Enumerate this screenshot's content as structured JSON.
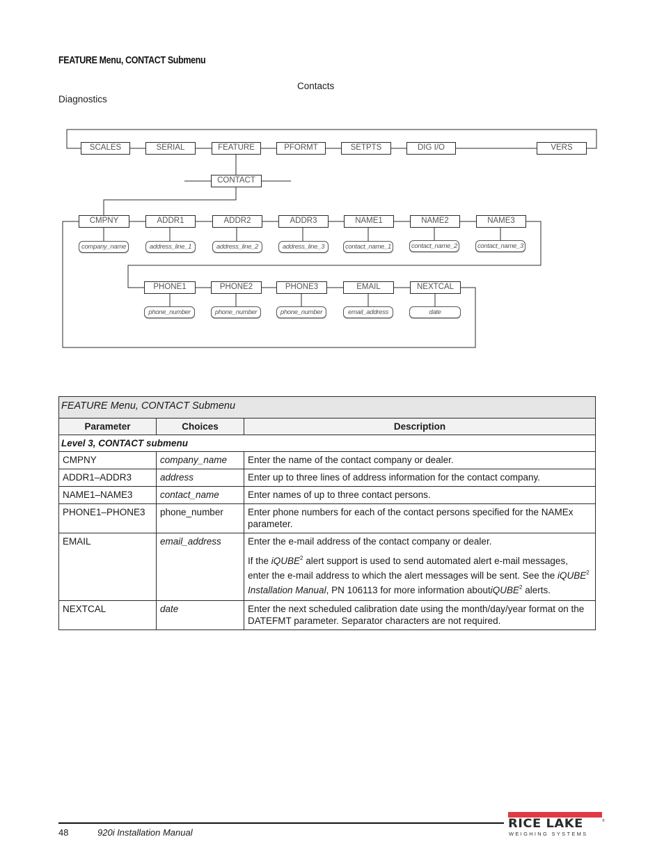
{
  "section_title": "FEATURE Menu, CONTACT Submenu",
  "figure_caption": "Contacts",
  "diagram_label": "Diagnostics",
  "diagram": {
    "top_menu": [
      "SCALES",
      "SERIAL",
      "FEATURE",
      "PFORMT",
      "SETPTS",
      "DIG I/O",
      "VERS"
    ],
    "submenu": "CONTACT",
    "row1": [
      {
        "param": "CMPNY",
        "choice": "company_name"
      },
      {
        "param": "ADDR1",
        "choice": "address_line_1"
      },
      {
        "param": "ADDR2",
        "choice": "address_line_2"
      },
      {
        "param": "ADDR3",
        "choice": "address_line_3"
      },
      {
        "param": "NAME1",
        "choice": "contact_name_1"
      },
      {
        "param": "NAME2",
        "choice": "contact_name_2"
      },
      {
        "param": "NAME3",
        "choice": "contact_name_3"
      }
    ],
    "row2": [
      {
        "param": "PHONE1",
        "choice": "phone_number"
      },
      {
        "param": "PHONE2",
        "choice": "phone_number"
      },
      {
        "param": "PHONE3",
        "choice": "phone_number"
      },
      {
        "param": "EMAIL",
        "choice": "email_address"
      },
      {
        "param": "NEXTCAL",
        "choice": "date"
      }
    ]
  },
  "table": {
    "caption": "FEATURE Menu, CONTACT Submenu",
    "headers": [
      "Parameter",
      "Choices",
      "Description"
    ],
    "level_label": "Level 3, CONTACT submenu",
    "rows": [
      {
        "parameter": "CMPNY",
        "choices": "company_name",
        "description": "Enter the name of the contact company or dealer."
      },
      {
        "parameter": "ADDR1–ADDR3",
        "choices": "address",
        "description": "Enter up to three lines of address information for the contact company."
      },
      {
        "parameter": "NAME1–NAME3",
        "choices": "contact_name",
        "description": "Enter names of up to three contact persons."
      },
      {
        "parameter": "PHONE1–PHONE3",
        "choices": "phone_number",
        "description": "Enter phone numbers for each of the contact persons specified for the NAMEx parameter."
      },
      {
        "parameter": "EMAIL",
        "choices": "email_address",
        "description": "Enter the e-mail address of the contact company or dealer.",
        "note": {
          "t1": "If the ",
          "i1": "iQUBE",
          "s1": "2",
          "t2": " alert support is used to send automated alert e-mail messages, enter the e-mail address to which the alert messages will be sent. See the ",
          "i2": "iQUBE",
          "s2": "2",
          "i3": "Installation Manual",
          "t3": ", PN 106113 for more information about",
          "i4": "iQUBE",
          "s3": "2",
          "t4": " alerts."
        }
      },
      {
        "parameter": "NEXTCAL",
        "choices": "date",
        "description": "Enter the next scheduled calibration date using the month/day/year format on the DATEFMT parameter. Separator characters are not required."
      }
    ]
  },
  "footer": {
    "page_number": "48",
    "manual_title": "920i Installation Manual",
    "logo_main": "RICE LAKE",
    "logo_reg": "®",
    "logo_sub": "WEIGHING SYSTEMS",
    "logo_accent_color": "#e03a44"
  }
}
